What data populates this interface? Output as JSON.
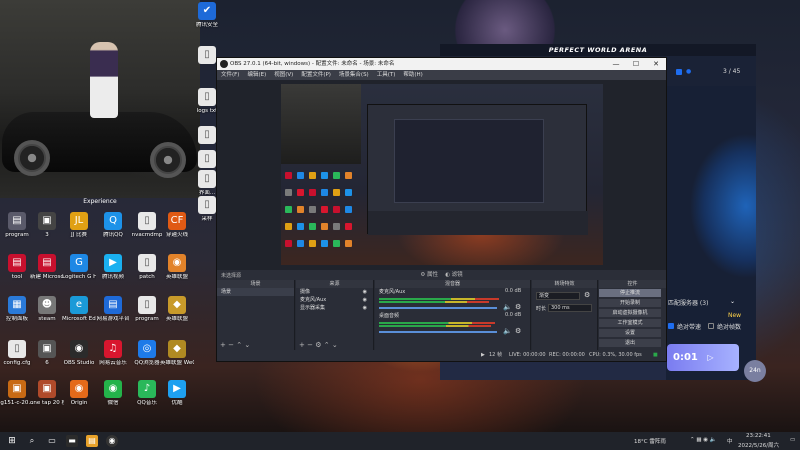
{
  "desktop": {
    "photo_caption": "Experience",
    "icons": [
      {
        "label": "program",
        "glyph": "▤",
        "color": "#5a5a6a",
        "col": 0,
        "row": 0
      },
      {
        "label": "3",
        "glyph": "▣",
        "color": "#444444",
        "col": 1,
        "row": 0
      },
      {
        "label": "JJ 比赛",
        "glyph": "JL",
        "color": "#e0a014",
        "col": 2,
        "row": 0
      },
      {
        "label": "腾讯QQ",
        "glyph": "Q",
        "color": "#1d92e8",
        "col": 3,
        "row": 0
      },
      {
        "label": "nvacmdmp",
        "glyph": "▯",
        "color": "#e8e8e8",
        "col": 4,
        "row": 0
      },
      {
        "label": "穿越火线",
        "glyph": "CF",
        "color": "#e05a14",
        "col": 5,
        "row": 0
      },
      {
        "label": "tool",
        "glyph": "▤",
        "color": "#c8102e",
        "col": 0,
        "row": 1
      },
      {
        "label": "新建 Microsoft...",
        "glyph": "▤",
        "color": "#c8102e",
        "col": 1,
        "row": 1
      },
      {
        "label": "Logitech G HUB",
        "glyph": "G",
        "color": "#1e88e5",
        "col": 2,
        "row": 1
      },
      {
        "label": "腾讯视频",
        "glyph": "▶",
        "color": "#1ab0f0",
        "col": 3,
        "row": 1
      },
      {
        "label": "patch",
        "glyph": "▯",
        "color": "#e8e8e8",
        "col": 4,
        "row": 1
      },
      {
        "label": "英雄联盟",
        "glyph": "◉",
        "color": "#e2832a",
        "col": 5,
        "row": 1
      },
      {
        "label": "控制面板",
        "glyph": "▦",
        "color": "#2a7ad8",
        "col": 0,
        "row": 2
      },
      {
        "label": "steam",
        "glyph": "☻",
        "color": "#777777",
        "col": 1,
        "row": 2
      },
      {
        "label": "Microsoft Edge",
        "glyph": "e",
        "color": "#1a9ad8",
        "col": 2,
        "row": 2
      },
      {
        "label": "网易游戏平台",
        "glyph": "▤",
        "color": "#1e6ad8",
        "col": 3,
        "row": 2
      },
      {
        "label": "program",
        "glyph": "▯",
        "color": "#e8e8e8",
        "col": 4,
        "row": 2
      },
      {
        "label": "英雄联盟",
        "glyph": "◆",
        "color": "#c89a2a",
        "col": 5,
        "row": 2
      },
      {
        "label": "config.cfg",
        "glyph": "▯",
        "color": "#e8e8e8",
        "col": 0,
        "row": 3
      },
      {
        "label": "6",
        "glyph": "▣",
        "color": "#555555",
        "col": 1,
        "row": 3
      },
      {
        "label": "OBS Studio",
        "glyph": "◉",
        "color": "#2b2b2b",
        "col": 2,
        "row": 3
      },
      {
        "label": "网易云音乐",
        "glyph": "♫",
        "color": "#d8162e",
        "col": 3,
        "row": 3
      },
      {
        "label": "QQ浏览器",
        "glyph": "◎",
        "color": "#1e7ae8",
        "col": 4,
        "row": 3
      },
      {
        "label": "英雄联盟 WeGame版",
        "glyph": "◆",
        "color": "#b08a22",
        "col": 5,
        "row": 3
      },
      {
        "label": "g151-c-20...",
        "glyph": "▣",
        "color": "#c86a14",
        "col": 0,
        "row": 4
      },
      {
        "label": "one tap 20 秒",
        "glyph": "▣",
        "color": "#b04a2a",
        "col": 1,
        "row": 4
      },
      {
        "label": "Origin",
        "glyph": "◉",
        "color": "#e46a1a",
        "col": 2,
        "row": 4
      },
      {
        "label": "微信",
        "glyph": "◉",
        "color": "#24b34a",
        "col": 3,
        "row": 4
      },
      {
        "label": "QQ音乐",
        "glyph": "♪",
        "color": "#2ab85a",
        "col": 4,
        "row": 4
      },
      {
        "label": "优酷",
        "glyph": "▶",
        "color": "#1ea0f0",
        "col": 5,
        "row": 4
      }
    ],
    "top_icons": [
      {
        "label": "腾讯安全",
        "glyph": "✔",
        "color": "#1e6ad8"
      },
      {
        "label": "",
        "glyph": "▯",
        "color": "#e8e8e8"
      },
      {
        "label": "logs txt",
        "glyph": "▯",
        "color": "#e8e8e8"
      },
      {
        "label": "",
        "glyph": "▯",
        "color": "#e8e8e8"
      },
      {
        "label": "",
        "glyph": "▯",
        "color": "#e8e8e8"
      },
      {
        "label": "界面...",
        "glyph": "▯",
        "color": "#e8e8e8"
      },
      {
        "label": "采样",
        "glyph": "▯",
        "color": "#e8e8e8"
      }
    ]
  },
  "pwa": {
    "title": "PERFECT WORLD ARENA",
    "server_count": "3 / 45",
    "server_label": "匹配服务器 (3)",
    "new_badge": "New",
    "check1": "绝对带速",
    "check2": "绝对帧数",
    "start_label": "0:01",
    "round_badge": "24n"
  },
  "obs": {
    "title": "OBS 27.0.1 (64-bit, windows) - 配置文件: 未命名 - 场景: 未命名",
    "menu": [
      "文件(F)",
      "编辑(E)",
      "视图(V)",
      "配置文件(P)",
      "场景集合(S)",
      "工具(T)",
      "帮助(H)"
    ],
    "controls_bar": [
      "⚙ 属性",
      "◐ 滤镜"
    ],
    "docks": {
      "scenes_header": "场景",
      "scenes": [
        "场景"
      ],
      "sources_header": "来源",
      "sources": [
        "摄像",
        "麦克风/Aux",
        "显示器采集"
      ],
      "mixer_header": "混音器",
      "mixer": [
        {
          "name": "麦克风/Aux",
          "level": "0.0 dB"
        },
        {
          "name": "桌面音频",
          "level": "0.0 dB"
        }
      ],
      "transitions_header": "转场特效",
      "transition_value": "渐变",
      "duration_label": "时长",
      "duration_value": "300 ms",
      "controls_header": "控件",
      "controls": [
        "停止推流",
        "开始录制",
        "启动虚拟摄像机",
        "工作室模式",
        "设置",
        "退出"
      ],
      "no_source": "未选择源"
    },
    "status": {
      "dropped": "12 帧",
      "live": "LIVE: 00:00:00",
      "rec": "REC: 00:00:00",
      "cpu": "CPU: 0.3%, 30.00 fps"
    }
  },
  "taskbar": {
    "weather": "18°C 雷阵雨",
    "time": "23:22:41",
    "date": "2022/5/26/周六",
    "lang": "中"
  }
}
